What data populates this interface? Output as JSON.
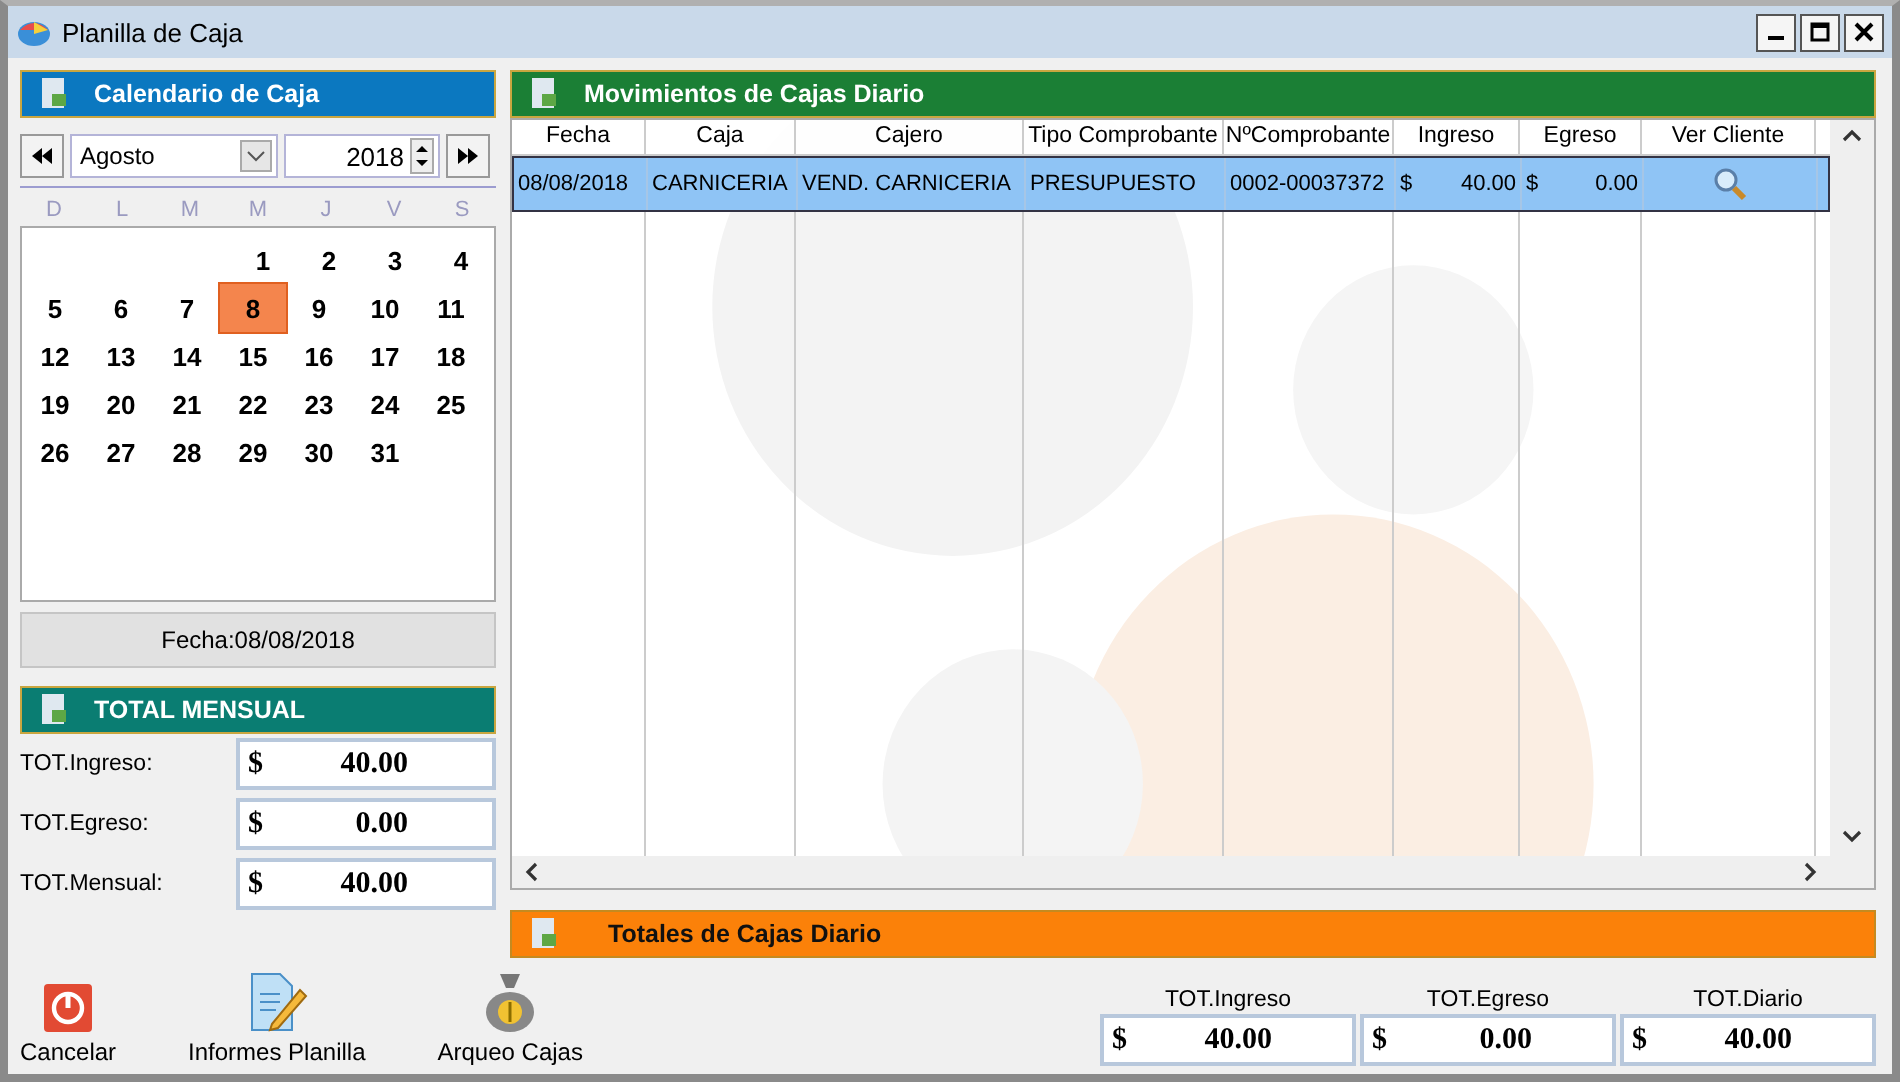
{
  "window": {
    "title": "Planilla de Caja"
  },
  "calendar": {
    "title": "Calendario de Caja",
    "month": "Agosto",
    "year": "2018",
    "weekdays": [
      "D",
      "L",
      "M",
      "M",
      "J",
      "V",
      "S"
    ],
    "weeks": [
      {
        "days": [
          {
            "label": "1",
            "selected": false
          },
          {
            "label": "2",
            "selected": false
          },
          {
            "label": "3",
            "selected": false
          },
          {
            "label": "4",
            "selected": false
          }
        ]
      },
      {
        "days": [
          {
            "label": "5",
            "selected": false
          },
          {
            "label": "6",
            "selected": false
          },
          {
            "label": "7",
            "selected": false
          },
          {
            "label": "8",
            "selected": true
          },
          {
            "label": "9",
            "selected": false
          },
          {
            "label": "10",
            "selected": false
          },
          {
            "label": "11",
            "selected": false
          }
        ]
      },
      {
        "days": [
          {
            "label": "12",
            "selected": false
          },
          {
            "label": "13",
            "selected": false
          },
          {
            "label": "14",
            "selected": false
          },
          {
            "label": "15",
            "selected": false
          },
          {
            "label": "16",
            "selected": false
          },
          {
            "label": "17",
            "selected": false
          },
          {
            "label": "18",
            "selected": false
          }
        ]
      },
      {
        "days": [
          {
            "label": "19",
            "selected": false
          },
          {
            "label": "20",
            "selected": false
          },
          {
            "label": "21",
            "selected": false
          },
          {
            "label": "22",
            "selected": false
          },
          {
            "label": "23",
            "selected": false
          },
          {
            "label": "24",
            "selected": false
          },
          {
            "label": "25",
            "selected": false
          }
        ]
      },
      {
        "days": [
          {
            "label": "26",
            "selected": false
          },
          {
            "label": "27",
            "selected": false
          },
          {
            "label": "28",
            "selected": false
          },
          {
            "label": "29",
            "selected": false
          },
          {
            "label": "30",
            "selected": false
          },
          {
            "label": "31",
            "selected": false
          }
        ]
      }
    ],
    "date_label": "Fecha:08/08/2018"
  },
  "monthly_total": {
    "title": "TOTAL MENSUAL",
    "fields": [
      {
        "label": "TOT.Ingreso:",
        "currency": "$",
        "value": "40.00"
      },
      {
        "label": "TOT.Egreso:",
        "currency": "$",
        "value": "0.00"
      },
      {
        "label": "TOT.Mensual:",
        "currency": "$",
        "value": "40.00"
      }
    ]
  },
  "movements": {
    "title": "Movimientos de Cajas Diario",
    "columns": [
      "Fecha",
      "Caja",
      "Cajero",
      "Tipo Comprobante",
      "NºComprobante",
      "Ingreso",
      "Egreso",
      "Ver Cliente"
    ],
    "rows": [
      {
        "selected": true,
        "fecha": "08/08/2018",
        "caja": "CARNICERIA",
        "cajero": "VEND. CARNICERIA",
        "tipo": "PRESUPUESTO",
        "numero": "0002-00037372",
        "ingreso_currency": "$",
        "ingreso": "40.00",
        "egreso_currency": "$",
        "egreso": "0.00"
      }
    ]
  },
  "daily_totals": {
    "title": "Totales de Cajas Diario",
    "fields": [
      {
        "label": "TOT.Ingreso",
        "currency": "$",
        "value": "40.00"
      },
      {
        "label": "TOT.Egreso",
        "currency": "$",
        "value": "0.00"
      },
      {
        "label": "TOT.Diario",
        "currency": "$",
        "value": "40.00"
      }
    ]
  },
  "buttons": [
    {
      "label": "Cancelar",
      "kind": "power"
    },
    {
      "label": "Informes Planilla",
      "kind": "document"
    },
    {
      "label": "Arqueo Cajas",
      "kind": "moneybag"
    }
  ]
}
